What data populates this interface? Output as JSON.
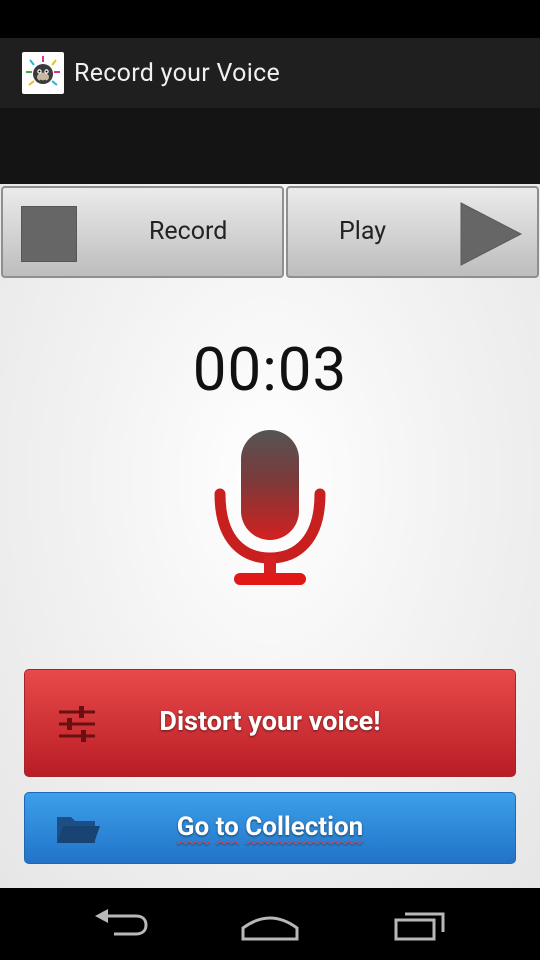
{
  "app": {
    "title": "Record your Voice",
    "icon": "monkey-face-app-icon"
  },
  "controls": {
    "record_label": "Record",
    "play_label": "Play",
    "record_icon": "stop-square-icon",
    "play_icon": "play-triangle-icon"
  },
  "recorder": {
    "timer": "00:03",
    "mic_icon": "microphone-icon"
  },
  "actions": {
    "distort_label": "Distort your voice!",
    "distort_icon": "sliders-icon",
    "collection_words": [
      "Go",
      "to",
      "Collection"
    ],
    "collection_icon": "folder-icon"
  },
  "colors": {
    "distort_button": "#d63238",
    "collection_button": "#2e8bdb",
    "mic_red": "#d42020"
  },
  "nav": {
    "icons": [
      "back-icon",
      "home-icon",
      "recent-apps-icon"
    ]
  }
}
